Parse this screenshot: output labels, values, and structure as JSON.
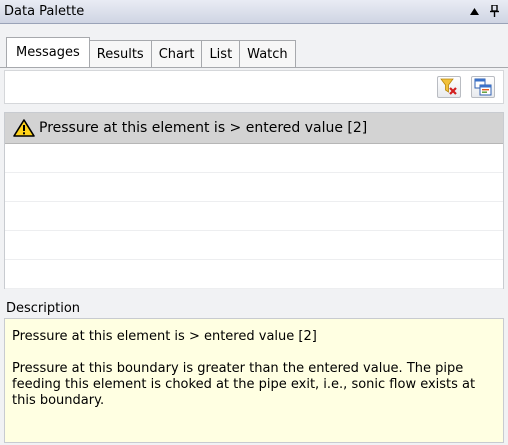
{
  "panel": {
    "title": "Data Palette",
    "controls": {
      "arrow": "▲",
      "pin": "ф"
    }
  },
  "tabs": [
    {
      "label": "Messages",
      "active": true
    },
    {
      "label": "Results"
    },
    {
      "label": "Chart"
    },
    {
      "label": "List"
    },
    {
      "label": "Watch"
    }
  ],
  "toolbar": {
    "clear_filter_icon": "funnel-clear-icon",
    "copy_icon": "copy-windows-icon"
  },
  "messages": [
    {
      "icon": "warning-icon",
      "text": "Pressure at this element is > entered value [2]",
      "selected": true
    }
  ],
  "description": {
    "label": "Description",
    "summary": "Pressure at this element is > entered value [2]",
    "detail": "Pressure at this boundary is greater than the entered value. The pipe feeding this element is choked at the pipe exit, i.e., sonic flow exists at this boundary."
  },
  "colors": {
    "description_bg": "#ffffe2",
    "selected_row_bg": "#d3d3d3",
    "warning_yellow": "#ffd31a"
  }
}
